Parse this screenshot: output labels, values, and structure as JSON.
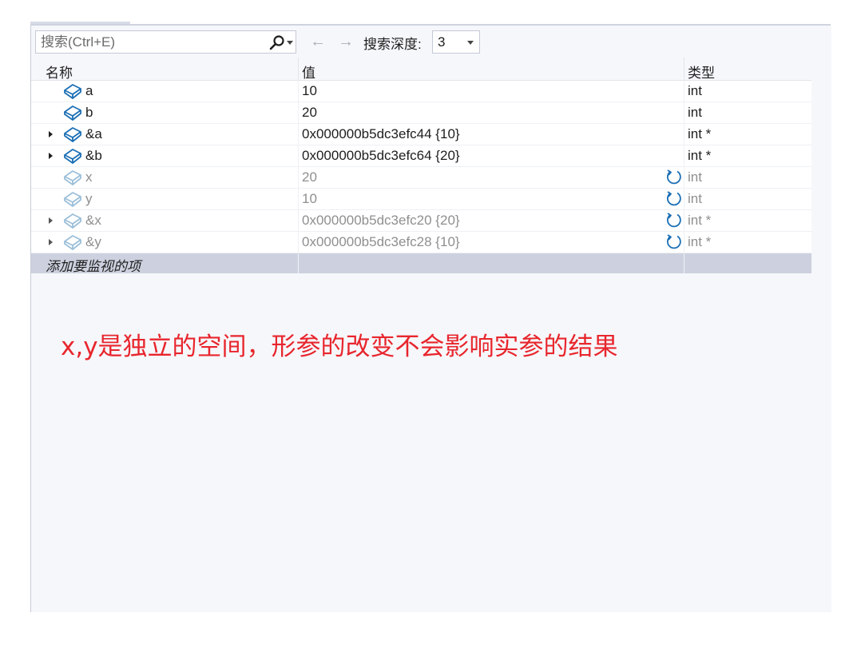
{
  "toolbar": {
    "search_placeholder": "搜索(Ctrl+E)",
    "back_arrow": "←",
    "forward_arrow": "→",
    "depth_label": "搜索深度:",
    "depth_value": "3",
    "icons": [
      "search-icon",
      "chevron-down-icon",
      "back-arrow-icon",
      "forward-arrow-icon"
    ]
  },
  "columns": {
    "name": "名称",
    "value": "值",
    "type": "类型"
  },
  "rows": [
    {
      "name": "a",
      "value": "10",
      "type": "int",
      "expandable": false,
      "stale": false
    },
    {
      "name": "b",
      "value": "20",
      "type": "int",
      "expandable": false,
      "stale": false
    },
    {
      "name": "&a",
      "value": "0x000000b5dc3efc44 {10}",
      "type": "int *",
      "expandable": true,
      "stale": false
    },
    {
      "name": "&b",
      "value": "0x000000b5dc3efc64 {20}",
      "type": "int *",
      "expandable": true,
      "stale": false
    },
    {
      "name": "x",
      "value": "20",
      "type": "int",
      "expandable": false,
      "stale": true
    },
    {
      "name": "y",
      "value": "10",
      "type": "int",
      "expandable": false,
      "stale": true
    },
    {
      "name": "&x",
      "value": "0x000000b5dc3efc20 {20}",
      "type": "int *",
      "expandable": true,
      "stale": true
    },
    {
      "name": "&y",
      "value": "0x000000b5dc3efc28 {10}",
      "type": "int *",
      "expandable": true,
      "stale": true
    }
  ],
  "add_watch_label": "添加要监视的项",
  "annotation": "x,y是独立的空间，形参的改变不会影响实参的结果",
  "colors": {
    "icon_active": "#1b6fb5",
    "icon_stale": "#9cbfd9",
    "annotation": "#e8262d",
    "stale_text": "#8f8f8f",
    "add_row_bg": "#cdd1df"
  }
}
